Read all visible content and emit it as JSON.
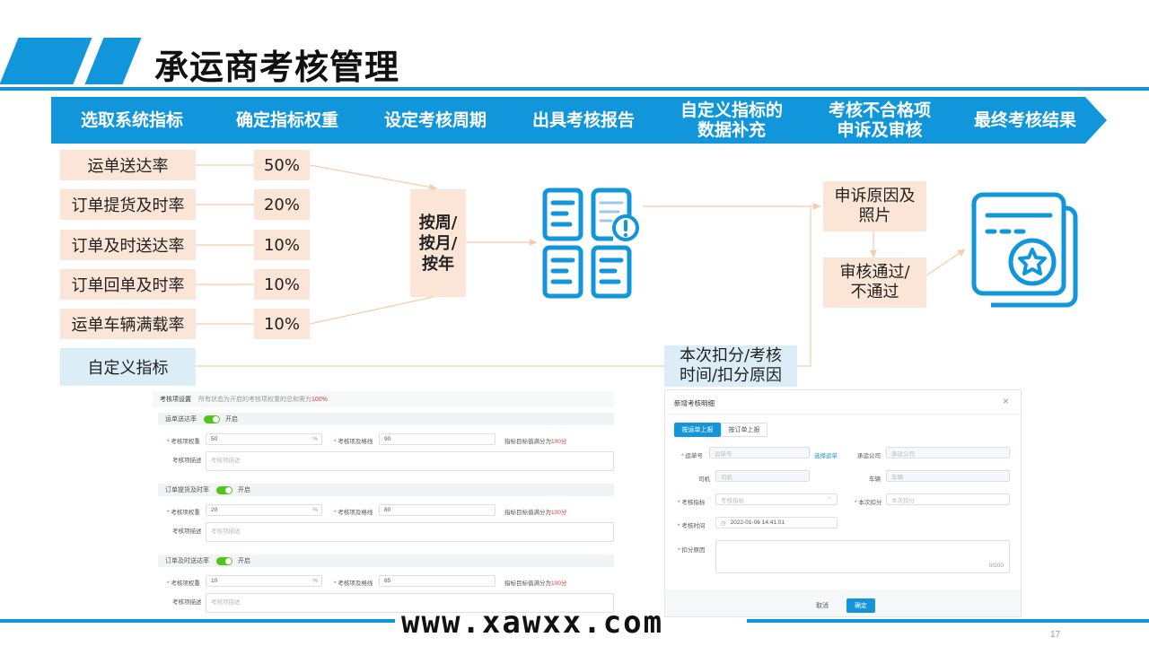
{
  "title": "承运商考核管理",
  "colors": {
    "brand": "#1296db",
    "peach": "#fbe5d6",
    "light_blue": "#dbeef7",
    "green": "#52c41a"
  },
  "steps": [
    "选取系统指标",
    "确定指标权重",
    "设定考核周期",
    "出具考核报告",
    "自定义指标的\n数据补充",
    "考核不合格项\n申诉及审核",
    "最终考核结果"
  ],
  "indicators": [
    "运单送达率",
    "订单提货及时率",
    "订单及时送达率",
    "订单回单及时率",
    "运单车辆满载率"
  ],
  "custom_indicator": "自定义指标",
  "weights": [
    "50%",
    "20%",
    "10%",
    "10%",
    "10%"
  ],
  "period": "按周/\n按月/\n按年",
  "appeal": "申诉原因及\n照片",
  "review": "审核通过/\n不通过",
  "supplement": "本次扣分/考核\n时间/扣分原因",
  "settings_panel": {
    "header": "考核项设置",
    "header_note": "所有状态为开启的考核项权重的总和需为",
    "header_note_value": "100%",
    "toggle_label": "开启",
    "weight_label": "考核项权重",
    "baseline_label": "考核项及格线",
    "desc_label": "考核项描述",
    "desc_placeholder": "考核项描述",
    "hint": "指标目标值满分为",
    "hint_value": "100分",
    "pct": "%",
    "sections": [
      {
        "name": "运单送达率",
        "weight": "50",
        "baseline": "90"
      },
      {
        "name": "订单提货及时率",
        "weight": "20",
        "baseline": "80"
      },
      {
        "name": "订单及时送达率",
        "weight": "10",
        "baseline": "85"
      }
    ]
  },
  "dialog": {
    "title": "新增考核明细",
    "close": "×",
    "tabs": [
      "按运单上报",
      "按订单上报"
    ],
    "waybill_label": "运单号",
    "waybill_placeholder": "运单号",
    "select_waybill": "选择运单",
    "carrier_label": "承运公司",
    "carrier_placeholder": "承运公司",
    "driver_label": "司机",
    "driver_placeholder": "司机",
    "vehicle_label": "车辆",
    "vehicle_placeholder": "车辆",
    "indicator_label": "考核指标",
    "indicator_placeholder": "考核指标",
    "deduct_label": "本次扣分",
    "deduct_placeholder": "本次扣分",
    "time_label": "考核时间",
    "time_value": "2022-01-06 14:41:01",
    "reason_label": "扣分原因",
    "reason_count": "0/200",
    "cancel": "取消",
    "confirm": "确定"
  },
  "watermark": "www.xawxx.com",
  "page_number": "17"
}
